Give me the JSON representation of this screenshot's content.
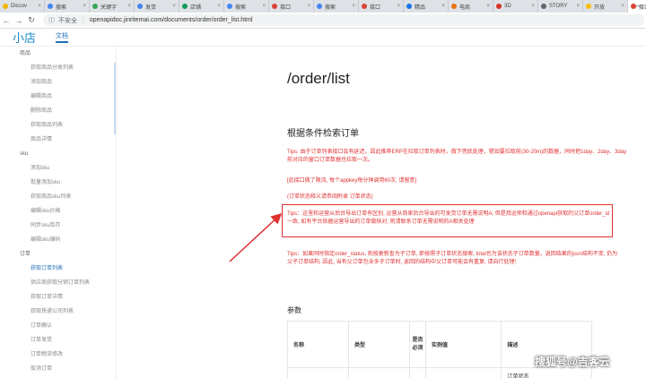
{
  "browser": {
    "tabs": [
      {
        "label": "Discov",
        "color": "#f4b400"
      },
      {
        "label": "搜索",
        "color": "#4285f4"
      },
      {
        "label": "关键字",
        "color": "#34a853"
      },
      {
        "label": "发货",
        "color": "#4285f4"
      },
      {
        "label": "店铺",
        "color": "#0f9d58"
      },
      {
        "label": "搜索",
        "color": "#4285f4"
      },
      {
        "label": "接口",
        "color": "#db4437"
      },
      {
        "label": "搜索",
        "color": "#4285f4"
      },
      {
        "label": "接口",
        "color": "#db4437"
      },
      {
        "label": "精品",
        "color": "#1a73e8"
      },
      {
        "label": "电商",
        "color": "#e8710a"
      },
      {
        "label": "3D",
        "color": "#d93025"
      },
      {
        "label": "STORY",
        "color": "#5f6368"
      },
      {
        "label": "开放",
        "color": "#fbbc04"
      },
      {
        "label": "接口",
        "color": "#db4437"
      }
    ],
    "active_tab_index": 14,
    "address": {
      "security_label": "不安全",
      "url": "openapidoc.jinritemai.com/documents/order/order_list.html"
    },
    "new_tab": "+",
    "minimize": "—"
  },
  "header": {
    "logo": "小店",
    "doc_link": "文档"
  },
  "sidebar": {
    "entries": [
      {
        "type": "group",
        "label": "商品"
      },
      {
        "type": "item",
        "label": "获取商品分类列表"
      },
      {
        "type": "item",
        "label": "添加商品"
      },
      {
        "type": "item",
        "label": "编辑商品"
      },
      {
        "type": "item",
        "label": "删除商品"
      },
      {
        "type": "item",
        "label": "获取商品列表"
      },
      {
        "type": "item",
        "label": "商品详情"
      },
      {
        "type": "group",
        "label": "sku"
      },
      {
        "type": "item",
        "label": "添加sku"
      },
      {
        "type": "item",
        "label": "批量添加sku"
      },
      {
        "type": "item",
        "label": "获取商品sku列表"
      },
      {
        "type": "item",
        "label": "编辑sku价格"
      },
      {
        "type": "item",
        "label": "同步sku库存"
      },
      {
        "type": "item",
        "label": "编辑sku编码"
      },
      {
        "type": "group",
        "label": "订单"
      },
      {
        "type": "item",
        "label": "获取订单列表",
        "active": true
      },
      {
        "type": "item",
        "label": "供应商获取分销订单列表"
      },
      {
        "type": "item",
        "label": "获取订单详情"
      },
      {
        "type": "item",
        "label": "获取快递公司列表"
      },
      {
        "type": "item",
        "label": "订单确认"
      },
      {
        "type": "item",
        "label": "订单发货"
      },
      {
        "type": "item",
        "label": "订单物流修改"
      },
      {
        "type": "item",
        "label": "取消订单"
      }
    ]
  },
  "main": {
    "title": "/order/list",
    "section_title": "根据条件检索订单",
    "tips1": "Tips: 由于订单列表接口会有延迟，因此推荐ERP在拉取订单列表时，做下兜底处理，譬如要拉取前(30-20m)的数据，同时把1day、2day、3day前对应的窗口订单数据也拉取一次。",
    "tips2": "[此接口做了限流, 每个appkey每分钟调用60次, 请留意]",
    "tips3": "(订单状态释义请参阅附录 订单状态)",
    "tips4": "Tips：这里和运营从后台导出订单有区别, 运营从商家后台导出的可发货订单无需说明A, 但是拜运师和通过openapi获取的父订单order_id一致, 如有平台依据运营导出的订单做核对, 则请联系订单无需说明的A相关处理",
    "tips5": "Tips：如果同时指定order_status, 则按更新查为子订单, 即按照子订单状态搜索, total也为该状态子订单数量。返回结果的json结构不变, 仍为父子订单结构, 因此, 当有父订单包含多子订单时, 返回的结构中父订单可能会有重复, 请自行处理!",
    "params_title": "参数",
    "table": {
      "headers": [
        "名称",
        "类型",
        "是否必须",
        "实例值",
        "描述"
      ],
      "row1": [
        "",
        "",
        "",
        "",
        "订单状态"
      ]
    }
  },
  "watermark": "搜狐号@吉客云"
}
